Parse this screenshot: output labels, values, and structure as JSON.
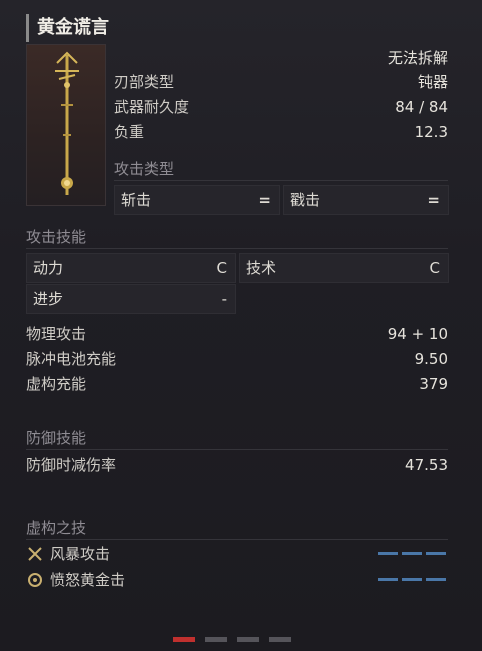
{
  "weapon": {
    "name": "黄金谎言",
    "status": "无法拆解"
  },
  "stats": [
    {
      "label": "刃部类型",
      "value": "钝器"
    },
    {
      "label": "武器耐久度",
      "value": "84 / 84"
    },
    {
      "label": "负重",
      "value": "12.3"
    }
  ],
  "attack_type": {
    "header": "攻击类型",
    "items": [
      {
        "label": "斩击",
        "value": "="
      },
      {
        "label": "戳击",
        "value": "="
      }
    ]
  },
  "attack_skill": {
    "header": "攻击技能",
    "items": [
      {
        "label": "动力",
        "value": "C"
      },
      {
        "label": "技术",
        "value": "C"
      },
      {
        "label": "进步",
        "value": "-"
      }
    ]
  },
  "attack_stats": [
    {
      "label": "物理攻击",
      "value": "94 + 10"
    },
    {
      "label": "脉冲电池充能",
      "value": "9.50"
    },
    {
      "label": "虚构充能",
      "value": "379"
    }
  ],
  "defense": {
    "header": "防御技能",
    "items": [
      {
        "label": "防御时减伤率",
        "value": "47.53"
      }
    ]
  },
  "fable_arts": {
    "header": "虚构之技",
    "items": [
      {
        "label": "风暴攻击",
        "icon": "crossed-swords-icon",
        "gauge": 3
      },
      {
        "label": "愤怒黄金击",
        "icon": "gear-emblem-icon",
        "gauge": 3
      }
    ]
  },
  "pagination": {
    "pages": 4,
    "active": 1
  },
  "colors": {
    "accent": "#c0302e",
    "gauge": "#4a77a8",
    "gold": "#c9a84a"
  }
}
